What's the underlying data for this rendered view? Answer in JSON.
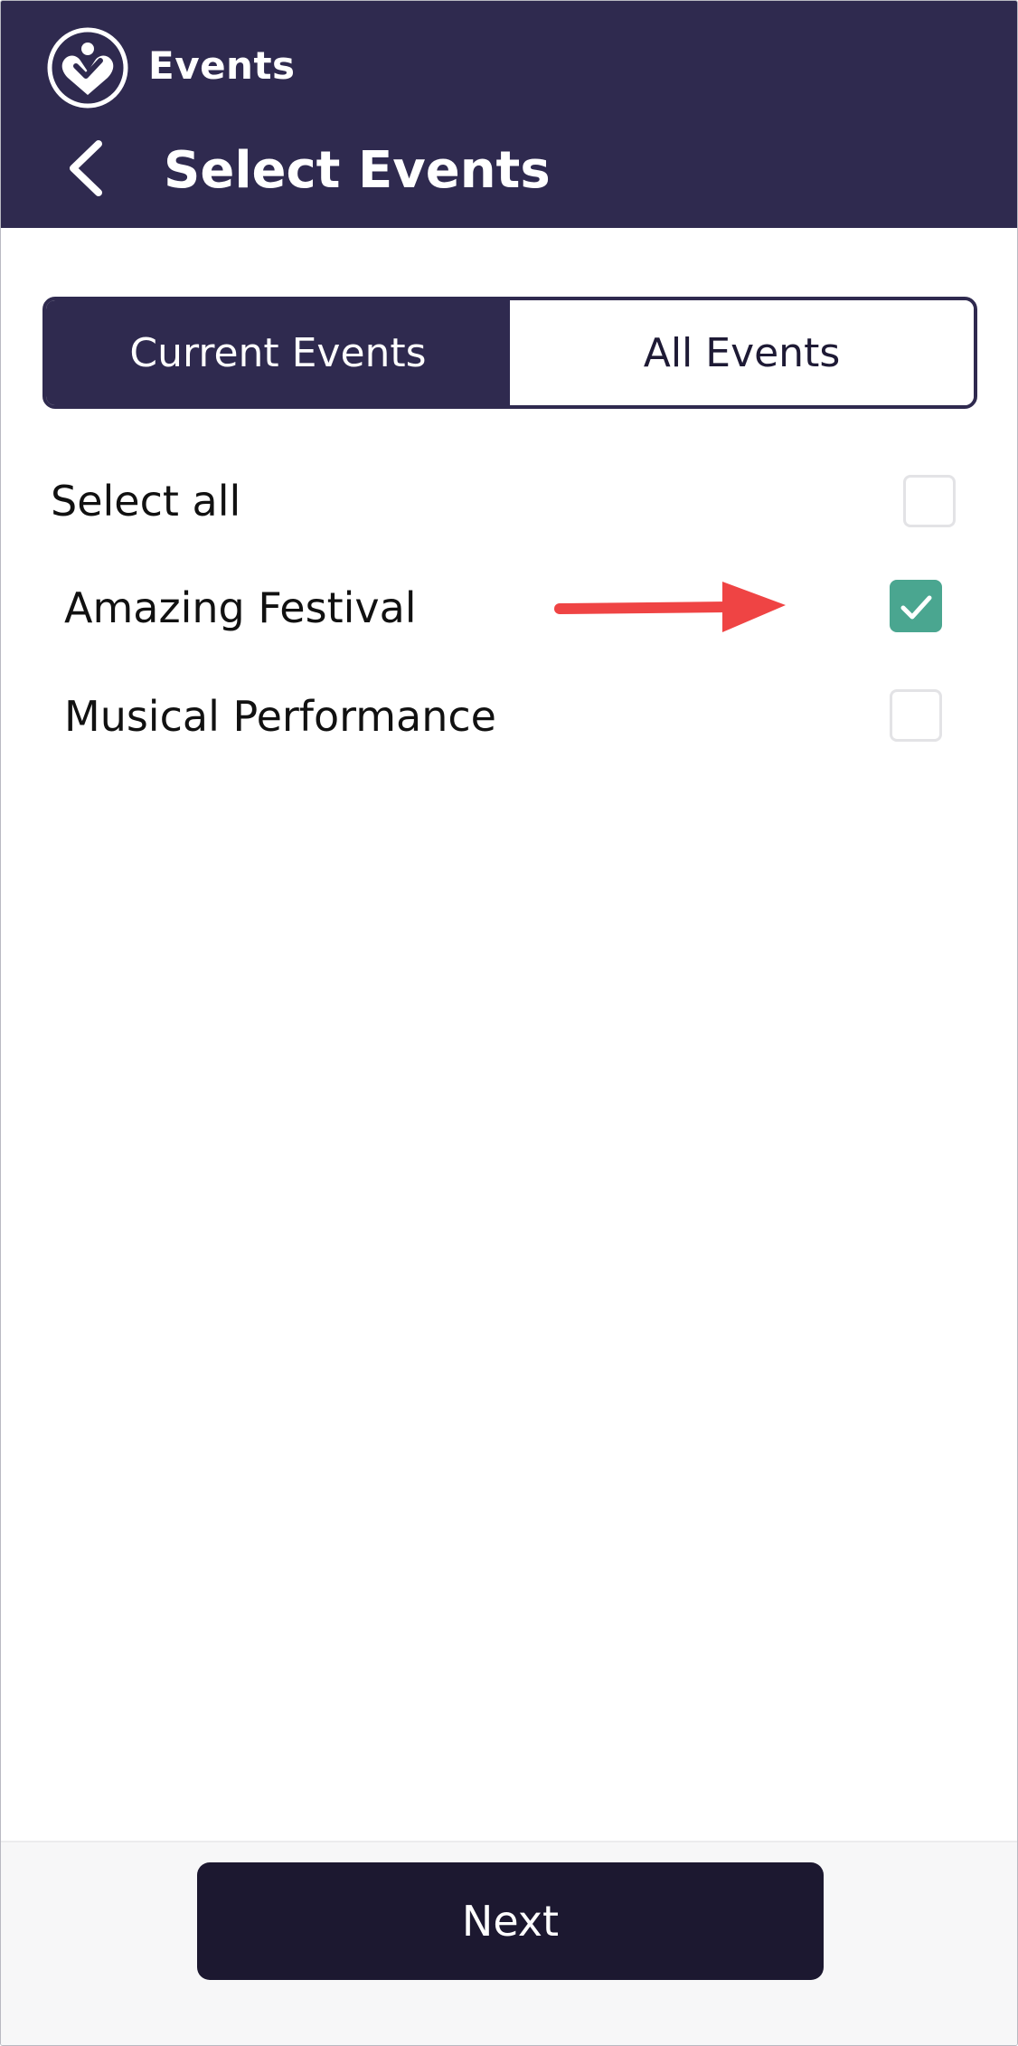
{
  "header": {
    "app_name": "Events",
    "logo_icon": "heart-check-icon",
    "back_icon": "chevron-left-icon",
    "title": "Select Events",
    "background_color": "#2f2a4f"
  },
  "tabs": [
    {
      "label": "Current Events",
      "active": true
    },
    {
      "label": "All Events",
      "active": false
    }
  ],
  "select_all": {
    "label": "Select all",
    "checked": false
  },
  "events": [
    {
      "label": "Amazing Festival",
      "checked": true
    },
    {
      "label": "Musical Performance",
      "checked": false
    }
  ],
  "annotation": {
    "icon": "red-arrow-right-icon",
    "color": "#ef4444"
  },
  "checkbox_checked_color": "#4aa690",
  "footer": {
    "next_label": "Next"
  }
}
